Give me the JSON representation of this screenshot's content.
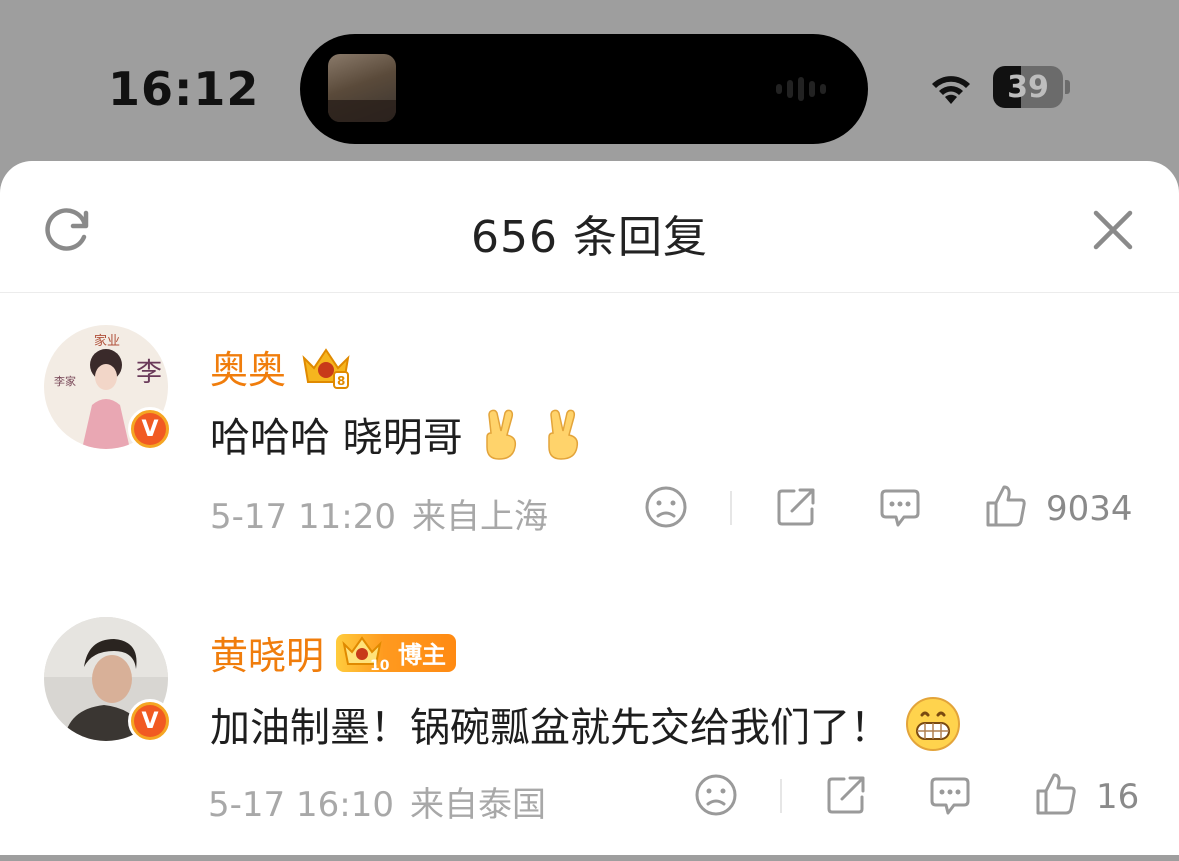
{
  "status_bar": {
    "time": "16:12",
    "battery": "39",
    "wifi_icon": "wifi-icon"
  },
  "sheet": {
    "title": "656 条回复",
    "refresh_icon": "refresh-icon",
    "close_icon": "close-icon"
  },
  "comments": [
    {
      "username": "奥奥",
      "level_badge": "crown-icon",
      "text": "哈哈哈 晓明哥",
      "emojis": [
        "victory-hand-emoji",
        "victory-hand-emoji"
      ],
      "date": "5-17 11:20",
      "location": "来自上海",
      "likes": "9034"
    },
    {
      "username": "黄晓明",
      "level_badge": "crown-icon",
      "host_tag": "博主",
      "host_level": "10",
      "text": "加油制墨！锅碗瓢盆就先交给我们了！",
      "emojis": [
        "grin-emoji"
      ],
      "date": "5-17 16:10",
      "location": "来自泰国",
      "likes": "16"
    }
  ],
  "colors": {
    "username": "#f07d0c",
    "meta": "#a8a8a8",
    "verify_badge": "#f15a22"
  }
}
